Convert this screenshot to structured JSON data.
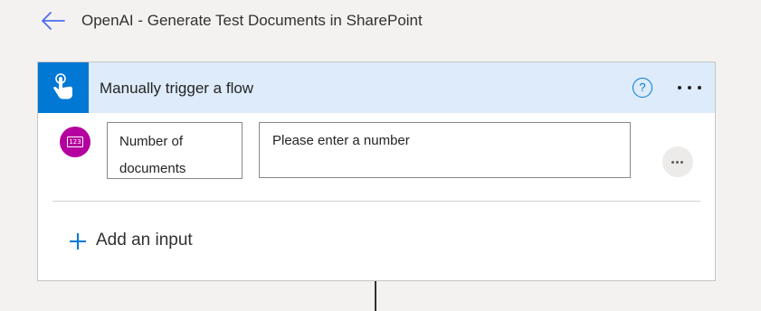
{
  "header": {
    "back_icon": "arrow-left-icon",
    "title": "OpenAI - Generate Test Documents in SharePoint"
  },
  "trigger_card": {
    "icon": "touch-hand-icon",
    "title": "Manually trigger a flow",
    "help_label": "?",
    "more_icon": "ellipsis-icon",
    "accent_color": "#0078d4",
    "header_color": "#ddebfb",
    "inputs": [
      {
        "type_icon": "number-icon",
        "type_glyph": "123",
        "icon_color": "#b4009e",
        "label_line1": "Number of",
        "label_line2": "documents",
        "value_text": "Please enter a number",
        "more_icon": "ellipsis-icon"
      }
    ],
    "add_input_label": "Add an input"
  }
}
